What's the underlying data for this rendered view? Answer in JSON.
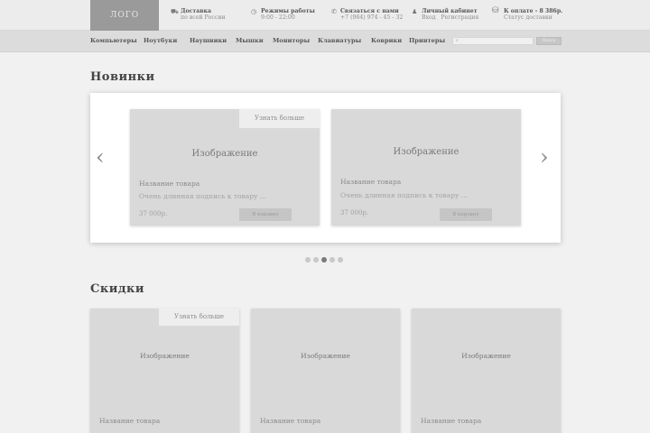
{
  "header": {
    "logo": "ЛОГО",
    "delivery": {
      "title": "Доставка",
      "sub": "по всей России"
    },
    "hours": {
      "title": "Режимы работы",
      "sub": "9:00 - 22:00"
    },
    "contact": {
      "title": "Связаться с нами",
      "sub": "+7 (964) 974 - 45 - 32"
    },
    "account": {
      "title": "Личный кабинет",
      "login": "Вход",
      "register": "Регистрация"
    },
    "cart": {
      "title": "К оплате - 8 386р.",
      "sub": "Статус доставки"
    }
  },
  "nav": {
    "items": [
      "Компьютеры",
      "Ноутбуки",
      "Наушники",
      "Мышки",
      "Мониторы",
      "Клавиатуры",
      "Коврики",
      "Принтеры"
    ],
    "search_button": "Поиск"
  },
  "new_section": {
    "title": "Новинки",
    "more_label": "Узнать больше",
    "cards": [
      {
        "image": "Изображение",
        "name": "Название товара",
        "desc": "Очень длинная подпись к товару ...",
        "price": "37 000р.",
        "cart": "В корзину"
      },
      {
        "image": "Изображение",
        "name": "Название товара",
        "desc": "Очень длинная подпись к товару ...",
        "price": "37 000р.",
        "cart": "В корзину"
      }
    ],
    "dots": 5,
    "active_dot": 3
  },
  "sale_section": {
    "title": "Скидки",
    "more_label": "Узнать больше",
    "cards": [
      {
        "image": "Изображение",
        "name": "Название товара"
      },
      {
        "image": "Изображение",
        "name": "Название товара"
      },
      {
        "image": "Изображение",
        "name": "Название товара"
      }
    ]
  },
  "icons": [
    "truck-icon",
    "clock-icon",
    "phone-icon",
    "user-icon",
    "basket-icon",
    "search-icon",
    "chevron-left-icon",
    "chevron-right-icon"
  ]
}
